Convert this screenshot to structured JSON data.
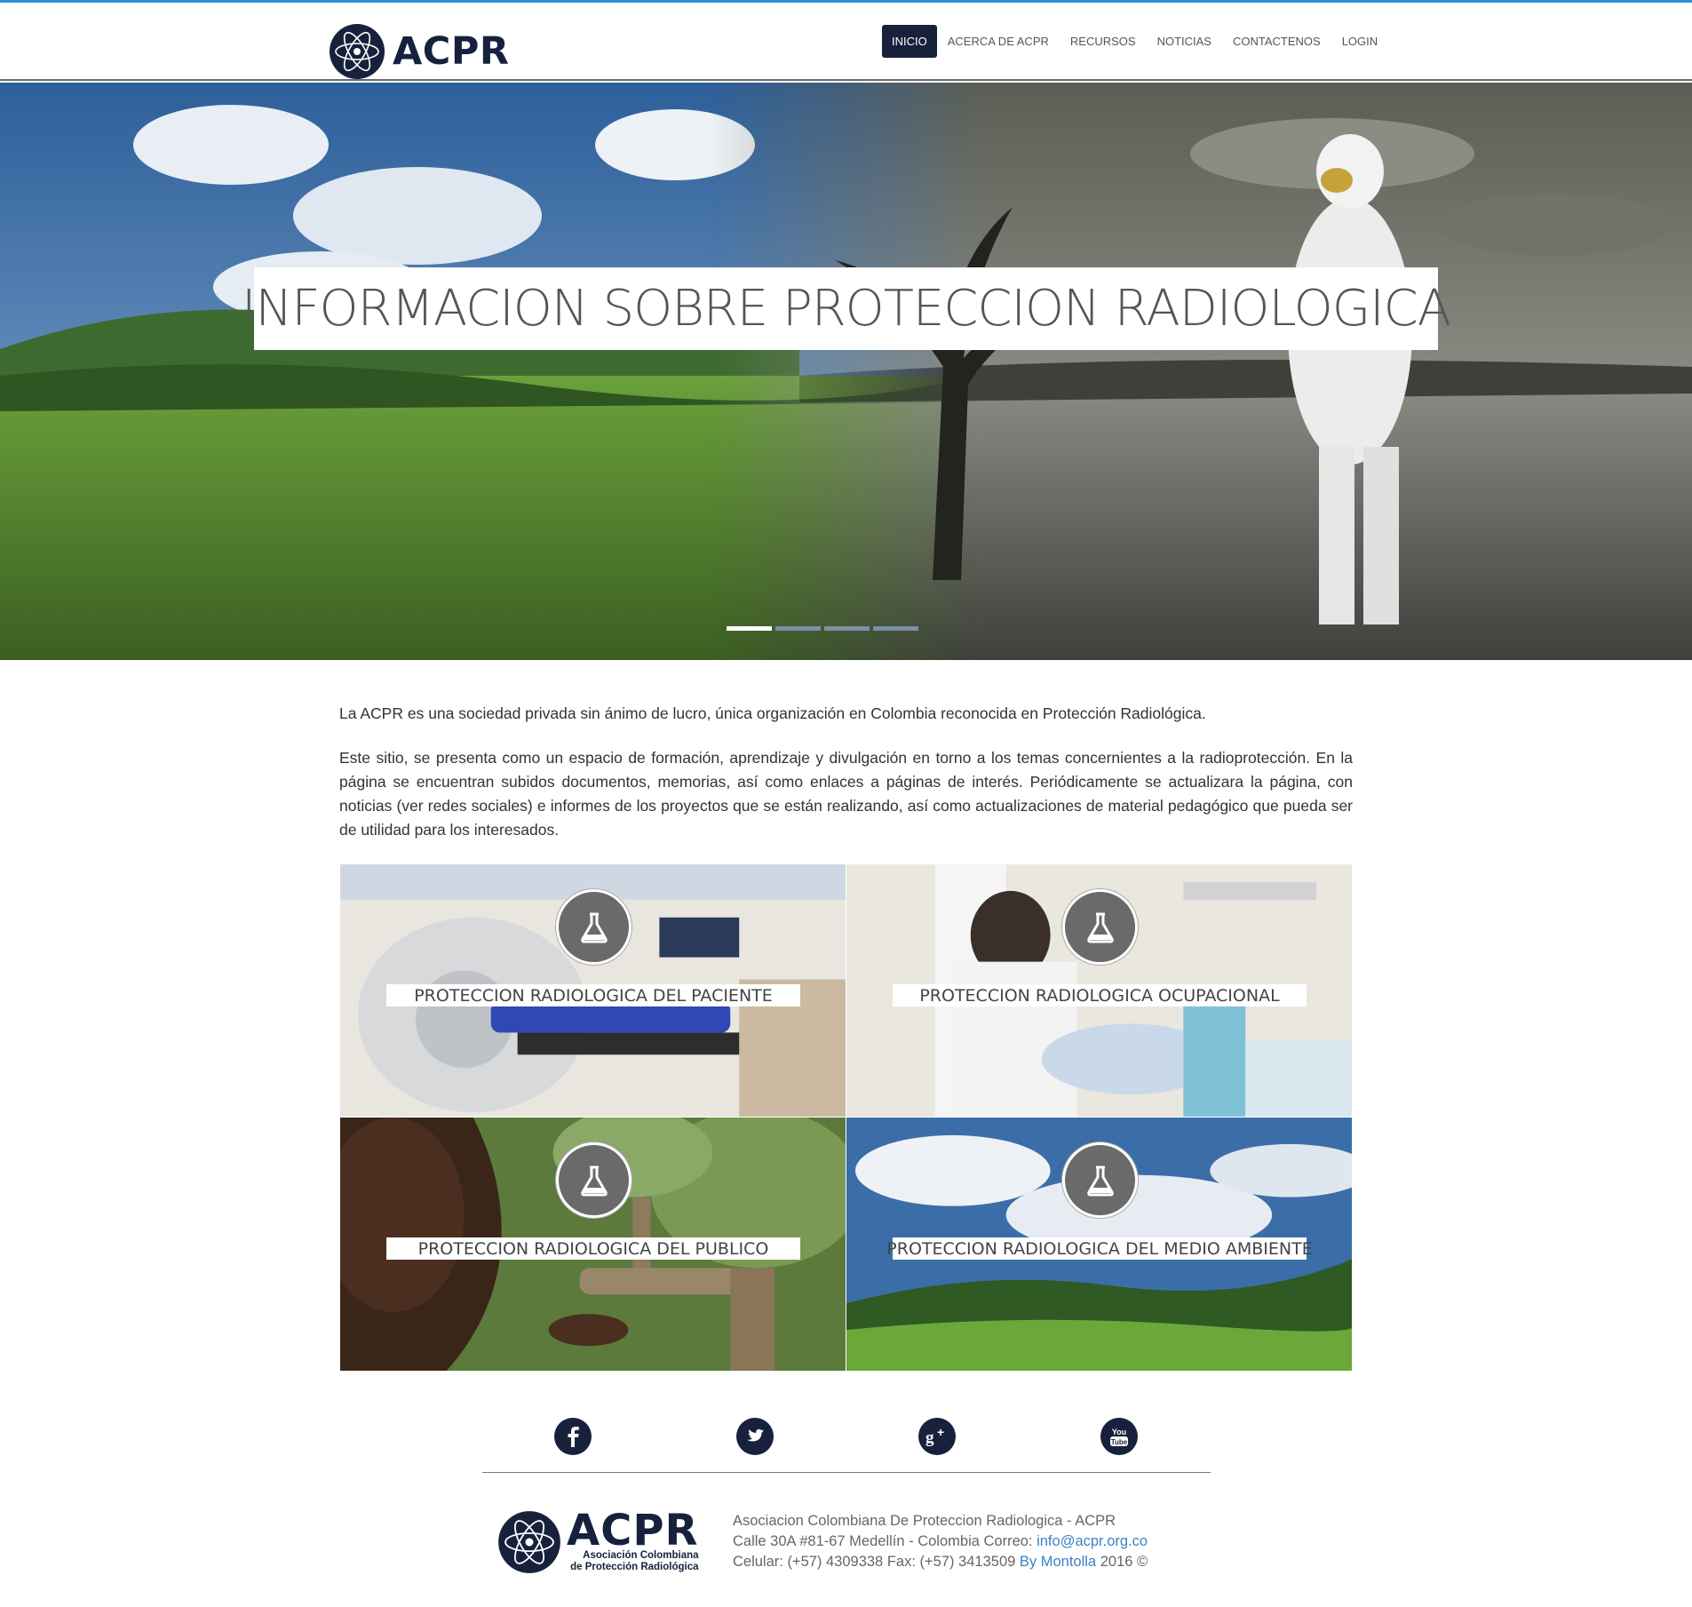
{
  "brand": {
    "name": "ACPR",
    "accent_color": "#2e8fd6",
    "navy_color": "#17213b"
  },
  "nav": {
    "items": [
      {
        "label": "INICIO",
        "active": true
      },
      {
        "label": "ACERCA DE ACPR",
        "active": false
      },
      {
        "label": "RECURSOS",
        "active": false
      },
      {
        "label": "NOTICIAS",
        "active": false
      },
      {
        "label": "CONTACTENOS",
        "active": false
      },
      {
        "label": "LOGIN",
        "active": false
      }
    ]
  },
  "hero": {
    "title": "INFORMACION SOBRE PROTECCION RADIOLOGICA",
    "slide_count": 4,
    "active_slide": 1
  },
  "intro": {
    "paragraph1": "La ACPR es una sociedad privada sin ánimo de lucro, única organización en Colombia reconocida en Protección Radiológica.",
    "paragraph2": "Este sitio, se presenta como un espacio de formación, aprendizaje y divulgación en torno a los temas concernientes a la radioprotección. En la página se encuentran subidos documentos, memorias, así como enlaces a páginas de interés. Periódicamente se actualizara la página, con noticias (ver redes sociales) e informes de los proyectos que se están realizando, así como actualizaciones de material pedagógico que pueda ser de utilidad para los interesados."
  },
  "tiles": [
    {
      "label": "PROTECCION RADIOLOGICA DEL PACIENTE",
      "icon": "flask-icon"
    },
    {
      "label": "PROTECCION RADIOLOGICA OCUPACIONAL",
      "icon": "flask-icon"
    },
    {
      "label": "PROTECCION RADIOLOGICA DEL PUBLICO",
      "icon": "flask-icon"
    },
    {
      "label": "PROTECCION RADIOLOGICA DEL MEDIO AMBIENTE",
      "icon": "flask-icon"
    }
  ],
  "social": [
    {
      "name": "facebook-icon",
      "glyph": "f"
    },
    {
      "name": "twitter-icon",
      "glyph": "t"
    },
    {
      "name": "google-plus-icon",
      "glyph": "g+"
    },
    {
      "name": "youtube-icon",
      "glyph": "You Tube"
    }
  ],
  "footer": {
    "logo_name": "ACPR",
    "logo_sub1": "Asociación Colombiana",
    "logo_sub2": "de Protección Radiológica",
    "line1": "Asociacion Colombiana De Proteccion Radiologica - ACPR",
    "line2_prefix": "Calle 30A #81-67 Medellín - Colombia Correo: ",
    "email": "info@acpr.org.co",
    "line3_prefix": "Celular: (+57) 4309338 Fax: (+57) 3413509 ",
    "by_link": "By Montolla",
    "line3_suffix": " 2016 ©"
  }
}
